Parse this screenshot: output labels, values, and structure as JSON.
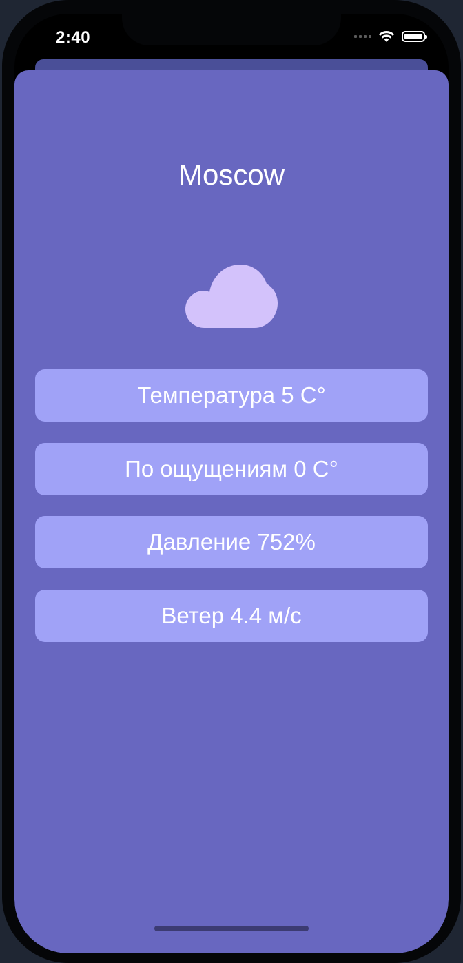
{
  "status_bar": {
    "time": "2:40",
    "icons": [
      "cellular-signal-icon",
      "wifi-icon",
      "battery-icon"
    ]
  },
  "weather": {
    "city": "Moscow",
    "condition_icon": "cloud-icon",
    "rows": [
      "Температура 5 C°",
      "По ощущениям 0 C°",
      "Давление 752%",
      "Ветер 4.4 м/с"
    ]
  },
  "colors": {
    "sheet_background": "#6867c0",
    "row_background": "#a0a2f7",
    "cloud": "#d3c2fb",
    "text": "#ffffff"
  }
}
